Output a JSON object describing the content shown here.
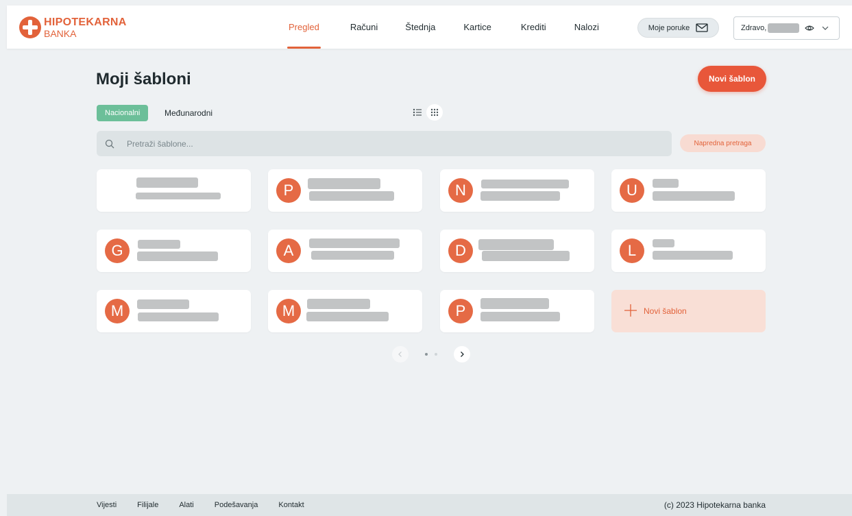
{
  "brand": {
    "name_line1": "HIPOTEKARNA",
    "name_line2": "BANKA",
    "accent": "#e2623a"
  },
  "nav": {
    "items": [
      "Pregled",
      "Računi",
      "Štednja",
      "Kartice",
      "Krediti",
      "Nalozi"
    ],
    "active_index": 0,
    "messages_label": "Moje poruke",
    "greeting": "Zdravo,"
  },
  "page": {
    "title": "Moji šabloni",
    "new_button": "Novi šablon",
    "tabs": [
      "Nacionalni",
      "Međunarodni"
    ],
    "active_tab": 0,
    "search_placeholder": "Pretraži šablone...",
    "advanced_search": "Napredna pretraga"
  },
  "templates": [
    {
      "initial": ""
    },
    {
      "initial": "P"
    },
    {
      "initial": "N"
    },
    {
      "initial": "U"
    },
    {
      "initial": "G"
    },
    {
      "initial": "A"
    },
    {
      "initial": "D"
    },
    {
      "initial": "L"
    },
    {
      "initial": "M"
    },
    {
      "initial": "M"
    },
    {
      "initial": "P"
    }
  ],
  "add_card_label": "Novi šablon",
  "pagination": {
    "pages": 2,
    "current": 1
  },
  "footer": {
    "links": [
      "Vijesti",
      "Filijale",
      "Alati",
      "Podešavanja",
      "Kontakt"
    ],
    "copyright": "(c) 2023 Hipotekarna banka"
  }
}
